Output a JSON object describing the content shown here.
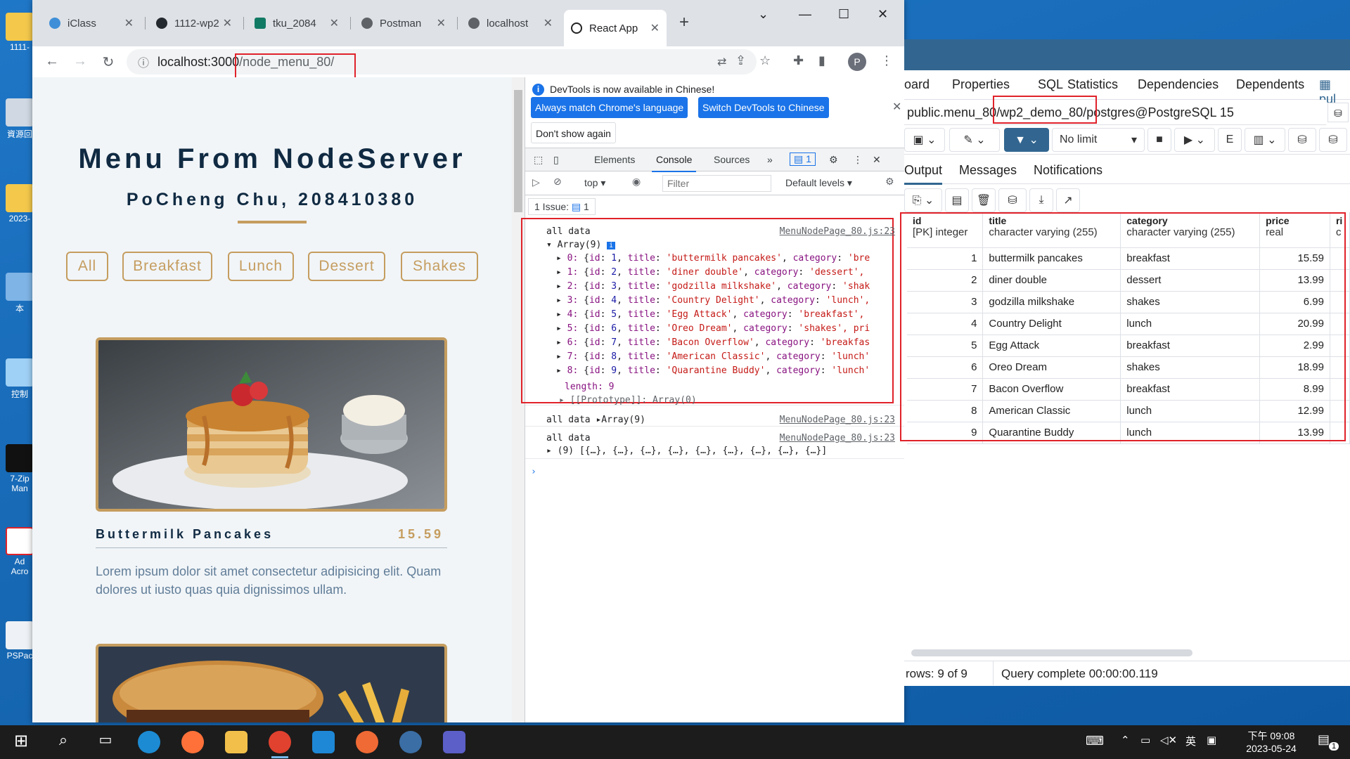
{
  "desktop": {
    "icons": [
      {
        "label": "1111-"
      },
      {
        "label": "資源回"
      },
      {
        "label": "2023-"
      },
      {
        "label": "本"
      },
      {
        "label": "控制"
      },
      {
        "label": "7-Zip Man"
      },
      {
        "label": "Ad Acro"
      },
      {
        "label": "PSPac"
      }
    ]
  },
  "browser": {
    "tabs": [
      {
        "label": "iClass",
        "color": "#3f8fd8"
      },
      {
        "label": "1112-wp2",
        "color": "#24292f"
      },
      {
        "label": "tku_2084",
        "color": "#117a65"
      },
      {
        "label": "Postman",
        "color": "#5f6368"
      },
      {
        "label": "localhost",
        "color": "#5f6368"
      },
      {
        "label": "React App",
        "color": "#61dafb"
      }
    ],
    "url_host": "localhost:3000",
    "url_path": "/node_menu_80/",
    "profile_initial": "P"
  },
  "menu_page": {
    "title": "Menu From NodeServer",
    "subtitle": "PoCheng Chu, 208410380",
    "filters": [
      "All",
      "Breakfast",
      "Lunch",
      "Dessert",
      "Shakes"
    ],
    "item": {
      "title": "Buttermilk Pancakes",
      "price": "15.59",
      "description": "Lorem ipsum dolor sit amet consectetur adipisicing elit. Quam dolores ut iusto quas quia dignissimos ullam."
    }
  },
  "devtools": {
    "info_text": "DevTools is now available in Chinese!",
    "btn_match": "Always match Chrome's language",
    "btn_switch": "Switch DevTools to Chinese",
    "btn_dont_show": "Don't show again",
    "tabs": [
      "Elements",
      "Console",
      "Sources"
    ],
    "issues_badge": "1",
    "context": "top",
    "filter_placeholder": "Filter",
    "levels": "Default levels",
    "issues_text": "1 Issue:",
    "issues_count": "1",
    "log_label": "all data",
    "source": "MenuNodePage_80.js:23",
    "array_head": "Array(9)",
    "rows": [
      {
        "idx": "0",
        "id": "1",
        "title": "'buttermilk pancakes'",
        "cat": "'bre"
      },
      {
        "idx": "1",
        "id": "2",
        "title": "'diner double'",
        "cat": "'dessert',"
      },
      {
        "idx": "2",
        "id": "3",
        "title": "'godzilla milkshake'",
        "cat": "'shak"
      },
      {
        "idx": "3",
        "id": "4",
        "title": "'Country Delight'",
        "cat": "'lunch',"
      },
      {
        "idx": "4",
        "id": "5",
        "title": "'Egg Attack'",
        "cat": "'breakfast',"
      },
      {
        "idx": "5",
        "id": "6",
        "title": "'Oreo Dream'",
        "cat": "'shakes', pri"
      },
      {
        "idx": "6",
        "id": "7",
        "title": "'Bacon Overflow'",
        "cat": "'breakfas"
      },
      {
        "idx": "7",
        "id": "8",
        "title": "'American Classic'",
        "cat": "'lunch'"
      },
      {
        "idx": "8",
        "id": "9",
        "title": "'Quarantine Buddy'",
        "cat": "'lunch'"
      }
    ],
    "length_line": "length: 9",
    "proto_line": "[[Prototype]]: Array(0)",
    "log2_value": "Array(9)",
    "log3_value": "(9) [{…}, {…}, {…}, {…}, {…}, {…}, {…}, {…}, {…}]"
  },
  "pgadmin": {
    "tabs": [
      "oard",
      "Properties",
      "SQL",
      "Statistics",
      "Dependencies",
      "Dependents",
      "pul"
    ],
    "connection_prefix": "public.menu_80",
    "connection_db": "/wp2_demo_80/",
    "connection_suffix": "postgres@PostgreSQL 15",
    "limit": "No limit",
    "subtabs": [
      "Output",
      "Messages",
      "Notifications"
    ],
    "columns": [
      {
        "name": "id",
        "type": "[PK] integer"
      },
      {
        "name": "title",
        "type": "character varying (255)"
      },
      {
        "name": "category",
        "type": "character varying (255)"
      },
      {
        "name": "price",
        "type": "real"
      },
      {
        "name": "ri",
        "type": "c"
      }
    ],
    "rows": [
      [
        "1",
        "buttermilk pancakes",
        "breakfast",
        "15.59"
      ],
      [
        "2",
        "diner double",
        "dessert",
        "13.99"
      ],
      [
        "3",
        "godzilla milkshake",
        "shakes",
        "6.99"
      ],
      [
        "4",
        "Country Delight",
        "lunch",
        "20.99"
      ],
      [
        "5",
        "Egg Attack",
        "breakfast",
        "2.99"
      ],
      [
        "6",
        "Oreo Dream",
        "shakes",
        "18.99"
      ],
      [
        "7",
        "Bacon Overflow",
        "breakfast",
        "8.99"
      ],
      [
        "8",
        "American Classic",
        "lunch",
        "12.99"
      ],
      [
        "9",
        "Quarantine Buddy",
        "lunch",
        "13.99"
      ]
    ],
    "status_rows": "rows: 9 of 9",
    "status_query": "Query complete 00:00:00.119"
  },
  "taskbar": {
    "time": "下午 09:08",
    "date": "2023-05-24",
    "ime": "英",
    "notif_count": "1"
  }
}
